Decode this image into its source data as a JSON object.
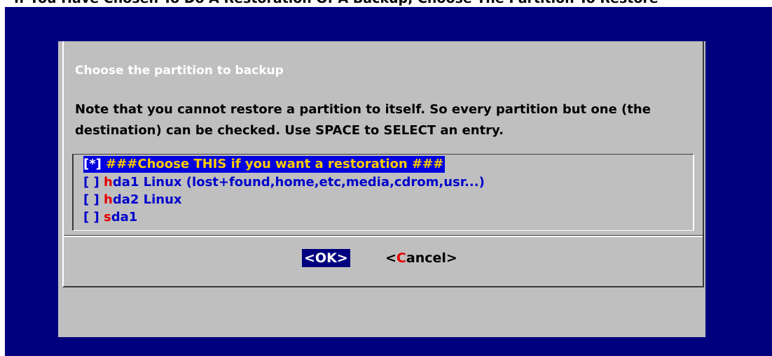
{
  "window": {
    "title_fragment": "If You Have Chosen To Do A Restoration Of A Backup, Choose The Partition To Restore"
  },
  "dialog": {
    "title": "Choose the partition to backup",
    "text": "Note that you cannot restore a partition to itself. So every partition but one (the destination) can be checked. Use SPACE to SELECT an entry."
  },
  "list": {
    "items": [
      {
        "marker": "[*]",
        "hotkey": "",
        "label": " ###Choose THIS if you want a restoration ###",
        "checked": true,
        "selected": true
      },
      {
        "marker": "[ ]",
        "hotkey": "h",
        "label": "da1 Linux (lost+found,home,etc,media,cdrom,usr...)",
        "checked": false,
        "selected": false
      },
      {
        "marker": "[ ]",
        "hotkey": "h",
        "label": "da2 Linux",
        "checked": false,
        "selected": false
      },
      {
        "marker": "[ ]",
        "hotkey": "s",
        "label": "da1",
        "checked": false,
        "selected": false
      }
    ]
  },
  "buttons": {
    "ok_label": "<OK>",
    "cancel_prefix": "<",
    "cancel_hotkey": "C",
    "cancel_rest": "ancel>"
  },
  "colors": {
    "screen_background": "#00007f",
    "dialog_background": "#bfbfbf",
    "item_text": "#0000cc",
    "hotkey": "#e60000",
    "selection_background": "#0000e0",
    "selection_text": "#ffcc00"
  }
}
